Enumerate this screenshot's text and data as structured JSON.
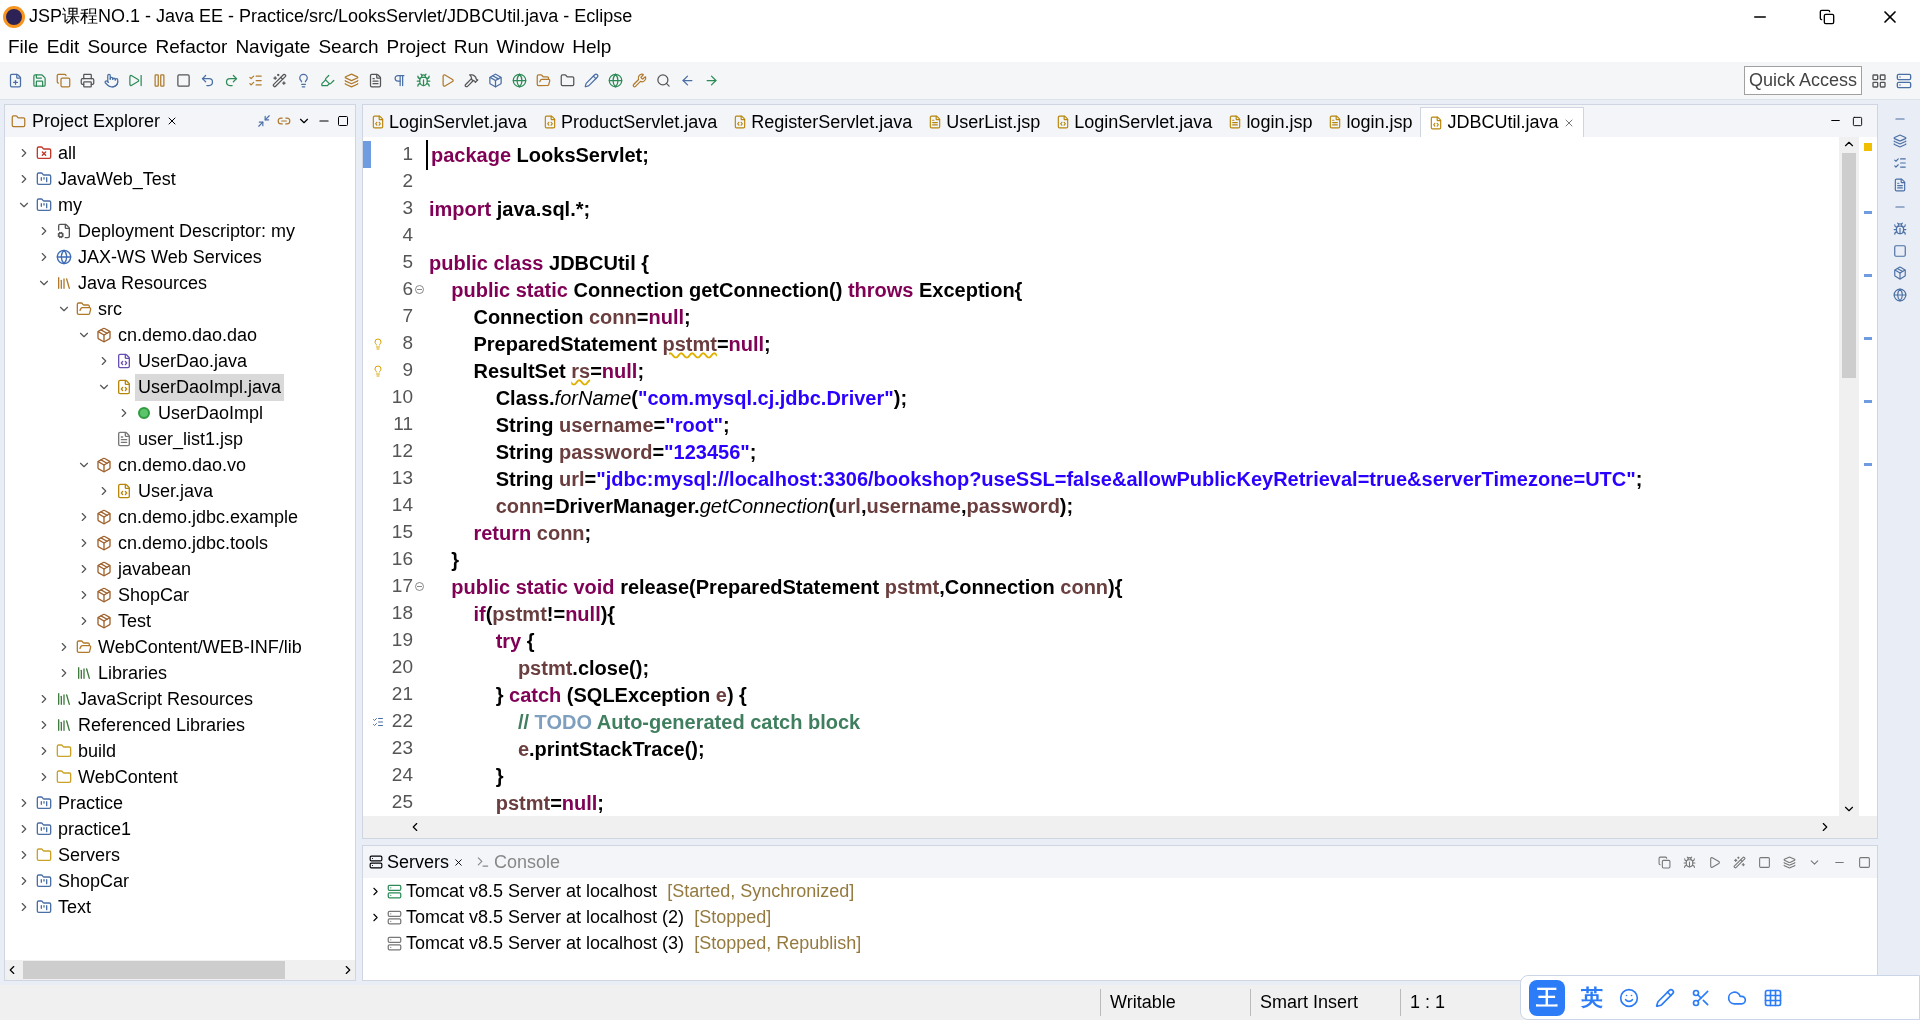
{
  "window": {
    "title": "JSP课程NO.1 - Java EE - Practice/src/LooksServlet/JDBCUtil.java - Eclipse"
  },
  "menu": [
    "File",
    "Edit",
    "Source",
    "Refactor",
    "Navigate",
    "Search",
    "Project",
    "Run",
    "Window",
    "Help"
  ],
  "toolbar": {
    "quick_access": "Quick Access"
  },
  "project_explorer": {
    "title": "Project Explorer",
    "tree": [
      {
        "label": "all",
        "kind": "closed-project",
        "expanded": false,
        "selected": false
      },
      {
        "label": "JavaWeb_Test",
        "kind": "project",
        "expanded": false,
        "selected": false
      },
      {
        "label": "my",
        "kind": "project",
        "expanded": true,
        "selected": false,
        "children": [
          {
            "label": "Deployment Descriptor: my",
            "kind": "descriptor",
            "expanded": false,
            "selected": false
          },
          {
            "label": "JAX-WS Web Services",
            "kind": "webservice",
            "expanded": false,
            "selected": false
          },
          {
            "label": "Java Resources",
            "kind": "resources",
            "expanded": true,
            "selected": false,
            "children": [
              {
                "label": "src",
                "kind": "srcfolder",
                "expanded": true,
                "selected": false,
                "children": [
                  {
                    "label": "cn.demo.dao.dao",
                    "kind": "package",
                    "expanded": true,
                    "selected": false,
                    "children": [
                      {
                        "label": "UserDao.java",
                        "kind": "interface",
                        "expanded": false,
                        "selected": false
                      },
                      {
                        "label": "UserDaoImpl.java",
                        "kind": "javafile",
                        "expanded": true,
                        "selected": true,
                        "children": [
                          {
                            "label": "UserDaoImpl",
                            "kind": "class",
                            "expanded": false,
                            "selected": false
                          }
                        ]
                      },
                      {
                        "label": "user_list1.jsp",
                        "kind": "jsp",
                        "selected": false
                      }
                    ]
                  },
                  {
                    "label": "cn.demo.dao.vo",
                    "kind": "package",
                    "expanded": true,
                    "selected": false,
                    "children": [
                      {
                        "label": "User.java",
                        "kind": "javafile",
                        "expanded": false,
                        "selected": false
                      }
                    ]
                  },
                  {
                    "label": "cn.demo.jdbc.example",
                    "kind": "package",
                    "expanded": false,
                    "selected": false
                  },
                  {
                    "label": "cn.demo.jdbc.tools",
                    "kind": "package",
                    "expanded": false,
                    "selected": false
                  },
                  {
                    "label": "javabean",
                    "kind": "package",
                    "expanded": false,
                    "selected": false
                  },
                  {
                    "label": "ShopCar",
                    "kind": "package",
                    "expanded": false,
                    "selected": false
                  },
                  {
                    "label": "Test",
                    "kind": "package",
                    "expanded": false,
                    "selected": false
                  }
                ]
              },
              {
                "label": "WebContent/WEB-INF/lib",
                "kind": "srcfolder",
                "expanded": false,
                "selected": false
              },
              {
                "label": "Libraries",
                "kind": "library",
                "expanded": false,
                "selected": false
              }
            ]
          },
          {
            "label": "JavaScript Resources",
            "kind": "library",
            "expanded": false,
            "selected": false
          },
          {
            "label": "Referenced Libraries",
            "kind": "library",
            "expanded": false,
            "selected": false
          },
          {
            "label": "build",
            "kind": "folder",
            "expanded": false,
            "selected": false
          },
          {
            "label": "WebContent",
            "kind": "folder",
            "expanded": false,
            "selected": false
          }
        ]
      },
      {
        "label": "Practice",
        "kind": "project",
        "expanded": false,
        "selected": false
      },
      {
        "label": "practice1",
        "kind": "project",
        "expanded": false,
        "selected": false
      },
      {
        "label": "Servers",
        "kind": "folder",
        "expanded": false,
        "selected": false
      },
      {
        "label": "ShopCar",
        "kind": "project",
        "expanded": false,
        "selected": false
      },
      {
        "label": "Text",
        "kind": "project",
        "expanded": false,
        "selected": false
      }
    ]
  },
  "editor": {
    "tabs": [
      {
        "label": "LoginServlet.java",
        "kind": "java",
        "selected": false
      },
      {
        "label": "ProductServlet.java",
        "kind": "java",
        "selected": false
      },
      {
        "label": "RegisterServlet.java",
        "kind": "java",
        "selected": false
      },
      {
        "label": "UserList.jsp",
        "kind": "jsp",
        "selected": false
      },
      {
        "label": "LoginServlet.java",
        "kind": "java",
        "selected": false
      },
      {
        "label": "login.jsp",
        "kind": "jsp",
        "selected": false
      },
      {
        "label": "login.jsp",
        "kind": "jsp",
        "selected": false
      },
      {
        "label": "JDBCUtil.java",
        "kind": "java",
        "selected": true
      }
    ],
    "lines": [
      {
        "number": "1",
        "current": true,
        "tokens": [
          {
            "kind": "keyword",
            "text": "package"
          },
          {
            "kind": "plain",
            "text": " LooksServlet;"
          }
        ]
      },
      {
        "number": "2",
        "current": false
      },
      {
        "number": "3",
        "current": false,
        "tokens": [
          {
            "kind": "keyword",
            "text": "import"
          },
          {
            "kind": "plain",
            "text": " java.sql.*;"
          }
        ]
      },
      {
        "number": "4",
        "current": false
      },
      {
        "number": "5",
        "current": false,
        "tokens": [
          {
            "kind": "keyword",
            "text": "public class"
          },
          {
            "kind": "plain",
            "text": " JDBCUtil {"
          }
        ]
      },
      {
        "number": "6",
        "current": false,
        "kind": "fold",
        "tokens": [
          {
            "kind": "keyword",
            "text": "    public static"
          },
          {
            "kind": "plain",
            "text": " Connection getConnection() "
          },
          {
            "kind": "keyword",
            "text": "throws"
          },
          {
            "kind": "plain",
            "text": " Exception{"
          }
        ]
      },
      {
        "number": "7",
        "current": false,
        "tokens": [
          {
            "kind": "plain",
            "text": "        Connection "
          },
          {
            "kind": "var",
            "text": "conn"
          },
          {
            "kind": "plain",
            "text": "="
          },
          {
            "kind": "keyword",
            "text": "null"
          },
          {
            "kind": "plain",
            "text": ";"
          }
        ]
      },
      {
        "number": "8",
        "current": false,
        "kind": "warning",
        "tokens": [
          {
            "kind": "plain",
            "text": "        PreparedStatement "
          },
          {
            "kind": "var_warning",
            "text": "pstmt"
          },
          {
            "kind": "plain",
            "text": "="
          },
          {
            "kind": "keyword",
            "text": "null"
          },
          {
            "kind": "plain",
            "text": ";"
          }
        ]
      },
      {
        "number": "9",
        "current": false,
        "kind": "warning",
        "tokens": [
          {
            "kind": "plain",
            "text": "        ResultSet "
          },
          {
            "kind": "var_warning",
            "text": "rs"
          },
          {
            "kind": "plain",
            "text": "="
          },
          {
            "kind": "keyword",
            "text": "null"
          },
          {
            "kind": "plain",
            "text": ";"
          }
        ]
      },
      {
        "number": "10",
        "current": false,
        "tokens": [
          {
            "kind": "plain",
            "text": "            Class."
          },
          {
            "kind": "static_method",
            "text": "forName"
          },
          {
            "kind": "plain",
            "text": "("
          },
          {
            "kind": "string",
            "text": "\"com.mysql.cj.jdbc.Driver\""
          },
          {
            "kind": "plain",
            "text": ");"
          }
        ]
      },
      {
        "number": "11",
        "current": false,
        "tokens": [
          {
            "kind": "plain",
            "text": "            String "
          },
          {
            "kind": "var",
            "text": "username"
          },
          {
            "kind": "plain",
            "text": "="
          },
          {
            "kind": "string",
            "text": "\"root\""
          },
          {
            "kind": "plain",
            "text": ";"
          }
        ]
      },
      {
        "number": "12",
        "current": false,
        "tokens": [
          {
            "kind": "plain",
            "text": "            String "
          },
          {
            "kind": "var",
            "text": "password"
          },
          {
            "kind": "plain",
            "text": "="
          },
          {
            "kind": "string",
            "text": "\"123456\""
          },
          {
            "kind": "plain",
            "text": ";"
          }
        ]
      },
      {
        "number": "13",
        "current": false,
        "tokens": [
          {
            "kind": "plain",
            "text": "            String "
          },
          {
            "kind": "var",
            "text": "url"
          },
          {
            "kind": "plain",
            "text": "="
          },
          {
            "kind": "string",
            "text": "\"jdbc:mysql://localhost:3306/bookshop?useSSL=false&allowPublicKeyRetrieval=true&serverTimezone=UTC\""
          },
          {
            "kind": "plain",
            "text": ";"
          }
        ]
      },
      {
        "number": "14",
        "current": false,
        "tokens": [
          {
            "kind": "var",
            "text": "            conn"
          },
          {
            "kind": "plain",
            "text": "=DriverManager."
          },
          {
            "kind": "static_method",
            "text": "getConnection"
          },
          {
            "kind": "plain",
            "text": "("
          },
          {
            "kind": "var",
            "text": "url"
          },
          {
            "kind": "plain",
            "text": ","
          },
          {
            "kind": "var",
            "text": "username"
          },
          {
            "kind": "plain",
            "text": ","
          },
          {
            "kind": "var",
            "text": "password"
          },
          {
            "kind": "plain",
            "text": ");"
          }
        ]
      },
      {
        "number": "15",
        "current": false,
        "tokens": [
          {
            "kind": "keyword",
            "text": "        return"
          },
          {
            "kind": "var",
            "text": " conn"
          },
          {
            "kind": "plain",
            "text": ";"
          }
        ]
      },
      {
        "number": "16",
        "current": false,
        "tokens": [
          {
            "kind": "plain",
            "text": "    }"
          }
        ]
      },
      {
        "number": "17",
        "current": false,
        "kind": "fold",
        "tokens": [
          {
            "kind": "keyword",
            "text": "    public static void"
          },
          {
            "kind": "plain",
            "text": " release(PreparedStatement "
          },
          {
            "kind": "var",
            "text": "pstmt"
          },
          {
            "kind": "plain",
            "text": ",Connection "
          },
          {
            "kind": "var",
            "text": "conn"
          },
          {
            "kind": "plain",
            "text": "){"
          }
        ]
      },
      {
        "number": "18",
        "current": false,
        "tokens": [
          {
            "kind": "keyword",
            "text": "        if"
          },
          {
            "kind": "plain",
            "text": "("
          },
          {
            "kind": "var",
            "text": "pstmt"
          },
          {
            "kind": "plain",
            "text": "!="
          },
          {
            "kind": "keyword",
            "text": "null"
          },
          {
            "kind": "plain",
            "text": "){"
          }
        ]
      },
      {
        "number": "19",
        "current": false,
        "tokens": [
          {
            "kind": "keyword",
            "text": "            try"
          },
          {
            "kind": "plain",
            "text": " {"
          }
        ]
      },
      {
        "number": "20",
        "current": false,
        "tokens": [
          {
            "kind": "var",
            "text": "                pstmt"
          },
          {
            "kind": "plain",
            "text": ".close();"
          }
        ]
      },
      {
        "number": "21",
        "current": false,
        "tokens": [
          {
            "kind": "plain",
            "text": "            } "
          },
          {
            "kind": "keyword",
            "text": "catch"
          },
          {
            "kind": "plain",
            "text": " (SQLException "
          },
          {
            "kind": "var",
            "text": "e"
          },
          {
            "kind": "plain",
            "text": ") {"
          }
        ]
      },
      {
        "number": "22",
        "current": false,
        "kind": "task",
        "tokens": [
          {
            "kind": "comment",
            "text": "                // "
          },
          {
            "kind": "todo",
            "text": "TODO"
          },
          {
            "kind": "comment",
            "text": " Auto-generated catch block"
          }
        ]
      },
      {
        "number": "23",
        "current": false,
        "tokens": [
          {
            "kind": "var",
            "text": "                e"
          },
          {
            "kind": "plain",
            "text": ".printStackTrace();"
          }
        ]
      },
      {
        "number": "24",
        "current": false,
        "tokens": [
          {
            "kind": "plain",
            "text": "            }"
          }
        ]
      },
      {
        "number": "25",
        "current": false,
        "tokens": [
          {
            "kind": "var",
            "text": "            pstmt"
          },
          {
            "kind": "plain",
            "text": "="
          },
          {
            "kind": "keyword",
            "text": "null"
          },
          {
            "kind": "plain",
            "text": ";"
          }
        ]
      }
    ]
  },
  "bottom_panel": {
    "tabs": [
      {
        "label": "Servers",
        "selected": true
      },
      {
        "label": "Console",
        "selected": false
      }
    ],
    "servers": [
      {
        "name": "Tomcat v8.5 Server at localhost",
        "status": "[Started, Synchronized]",
        "running": true,
        "expanded": false
      },
      {
        "name": "Tomcat v8.5 Server at localhost (2)",
        "status": "[Stopped]",
        "running": false,
        "expanded": false
      },
      {
        "name": "Tomcat v8.5 Server at localhost (3)",
        "status": "[Stopped, Republish]",
        "running": false
      }
    ]
  },
  "status_bar": [
    "Writable",
    "Smart Insert",
    "1 : 1"
  ],
  "ime_toolbar": {
    "logo": "王",
    "mode": "英"
  }
}
